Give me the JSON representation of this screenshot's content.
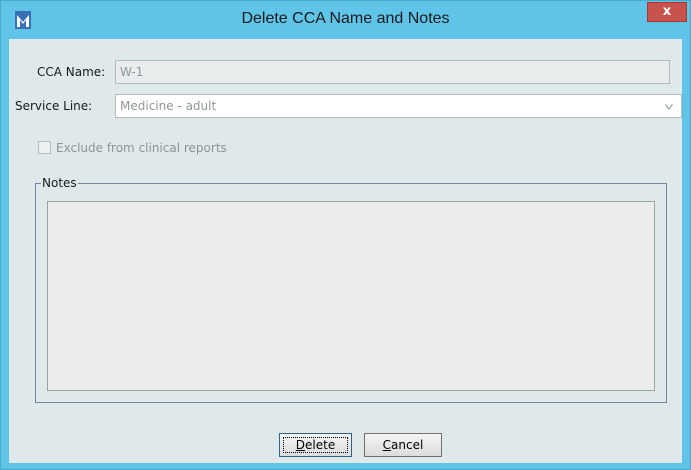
{
  "window": {
    "title": "Delete CCA Name and Notes",
    "close_label": "x",
    "colors": {
      "titlebar": "#5fc4e8",
      "client": "#dfe9ea",
      "close": "#c7534a"
    }
  },
  "form": {
    "cca_name_label": "CCA Name:",
    "cca_name_value": "W-1",
    "service_line_label": "Service Line:",
    "service_line_value": "Medicine - adult",
    "exclude_label": "Exclude from clinical reports",
    "exclude_checked": false,
    "notes_label": "Notes",
    "notes_value": ""
  },
  "buttons": {
    "delete_mnemonic": "D",
    "delete_rest": "elete",
    "cancel_mnemonic": "C",
    "cancel_rest": "ancel"
  }
}
